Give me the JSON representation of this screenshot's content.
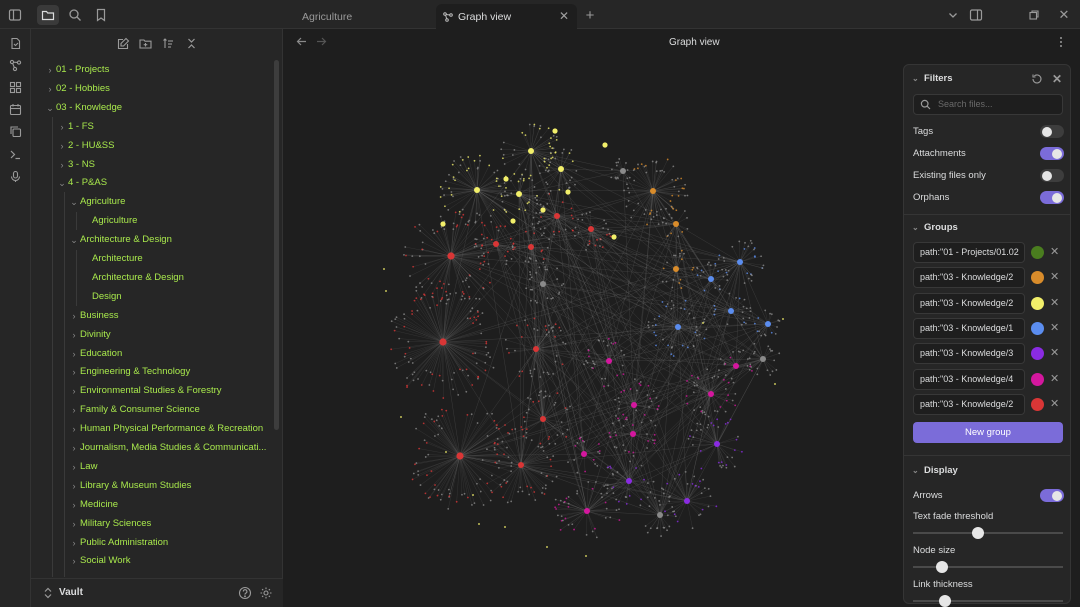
{
  "colors": {
    "accent": "#7b6cd9",
    "tree_text": "#a8e84c",
    "link": "#6f6f6f",
    "node_default": "#8a8a8a"
  },
  "topbar": {
    "left_icons": [
      "sidebar-toggle-icon",
      "folder-icon",
      "search-icon",
      "bookmark-icon"
    ],
    "tabs": [
      {
        "label": "Agriculture",
        "active": false
      },
      {
        "label": "Graph view",
        "active": true,
        "icon": "graph-icon"
      }
    ],
    "new_tab": "+",
    "right_icons": [
      "chevron-down-icon",
      "sidebar-right-icon",
      "restore-icon",
      "close-icon"
    ]
  },
  "ribbon": {
    "icons": [
      "file-open-icon",
      "graph-icon",
      "blocks-icon",
      "calendar-icon",
      "copy-icon",
      "terminal-icon",
      "microphone-icon"
    ]
  },
  "sidebar": {
    "tool_icons": [
      "new-note-icon",
      "new-folder-icon",
      "sort-icon",
      "collapse-icon"
    ],
    "tree": [
      {
        "label": "01 - Projects",
        "chevron": "›"
      },
      {
        "label": "02 - Hobbies",
        "chevron": "›"
      },
      {
        "label": "03 - Knowledge",
        "chevron": "⌄"
      },
      {
        "label": "1 - FS",
        "chevron": "›"
      },
      {
        "label": "2 - HU&SS",
        "chevron": "›"
      },
      {
        "label": "3 - NS",
        "chevron": "›"
      },
      {
        "label": "4 - P&AS",
        "chevron": "⌄"
      },
      {
        "label": "Agriculture",
        "chevron": "⌄"
      },
      {
        "label": "Agriculture",
        "chevron": ""
      },
      {
        "label": "Architecture & Design",
        "chevron": "⌄"
      },
      {
        "label": "Architecture",
        "chevron": ""
      },
      {
        "label": "Architecture & Design",
        "chevron": ""
      },
      {
        "label": "Design",
        "chevron": ""
      },
      {
        "label": "Business",
        "chevron": "›"
      },
      {
        "label": "Divinity",
        "chevron": "›"
      },
      {
        "label": "Education",
        "chevron": "›"
      },
      {
        "label": "Engineering & Technology",
        "chevron": "›"
      },
      {
        "label": "Environmental Studies & Forestry",
        "chevron": "›"
      },
      {
        "label": "Family & Consumer Science",
        "chevron": "›"
      },
      {
        "label": "Human Physical Performance & Recreation",
        "chevron": "›"
      },
      {
        "label": "Journalism, Media Studies & Communicati...",
        "chevron": "›"
      },
      {
        "label": "Law",
        "chevron": "›"
      },
      {
        "label": "Library & Museum Studies",
        "chevron": "›"
      },
      {
        "label": "Medicine",
        "chevron": "›"
      },
      {
        "label": "Military Sciences",
        "chevron": "›"
      },
      {
        "label": "Public Administration",
        "chevron": "›"
      },
      {
        "label": "Social Work",
        "chevron": "›"
      }
    ],
    "vault": {
      "label": "Vault",
      "icons": [
        "help-icon",
        "settings-icon"
      ]
    }
  },
  "main": {
    "title": "Graph view",
    "nav": [
      "back-arrow-icon",
      "forward-arrow-icon"
    ],
    "menu": "more-options-icon"
  },
  "filters": {
    "title": "Filters",
    "search_placeholder": "Search files...",
    "toggles": [
      {
        "label": "Tags",
        "on": false
      },
      {
        "label": "Attachments",
        "on": true
      },
      {
        "label": "Existing files only",
        "on": false
      },
      {
        "label": "Orphans",
        "on": true
      }
    ]
  },
  "groups": {
    "title": "Groups",
    "items": [
      {
        "query": "path:\"01 - Projects/01.02",
        "color": "#4a7d1f"
      },
      {
        "query": "path:\"03 - Knowledge/2",
        "color": "#d98c2b"
      },
      {
        "query": "path:\"03 - Knowledge/2",
        "color": "#f2ef6a"
      },
      {
        "query": "path:\"03 - Knowledge/1",
        "color": "#5b8def"
      },
      {
        "query": "path:\"03 - Knowledge/3",
        "color": "#8a2be2"
      },
      {
        "query": "path:\"03 - Knowledge/4",
        "color": "#d4179e"
      },
      {
        "query": "path:\"03 - Knowledge/2",
        "color": "#d93636"
      }
    ],
    "new_group": "New group"
  },
  "display": {
    "title": "Display",
    "arrows": {
      "label": "Arrows",
      "on": true
    },
    "sliders": [
      {
        "label": "Text fade threshold",
        "value": 0.43
      },
      {
        "label": "Node size",
        "value": 0.19
      },
      {
        "label": "Link thickness",
        "value": 0.21
      }
    ]
  }
}
